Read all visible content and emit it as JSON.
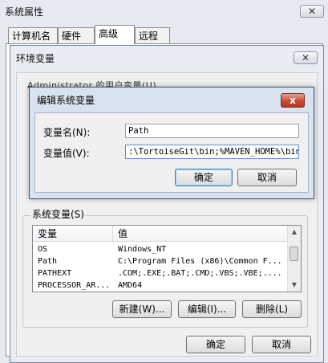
{
  "outer_window": {
    "title": "系统属性",
    "close": "✕",
    "tabs": [
      "计算机名",
      "硬件",
      "高级",
      "远程"
    ]
  },
  "env_dialog": {
    "title": "环境变量",
    "close": "✕",
    "user_vars_label": "Administrator 的用户变量(U)",
    "system_vars_label": "系统变量(S)",
    "table": {
      "headers": [
        "变量",
        "值"
      ],
      "rows": [
        [
          "OS",
          "Windows_NT"
        ],
        [
          "Path",
          "C:\\Program Files (x86)\\Common F..."
        ],
        [
          "PATHEXT",
          ".COM;.EXE;.BAT;.CMD;.VBS;.VBE;...."
        ],
        [
          "PROCESSOR_AR...",
          "AMD64"
        ]
      ]
    },
    "buttons": {
      "new": "新建(W)...",
      "edit": "编辑(I)...",
      "delete": "删除(L)"
    },
    "ok": "确定",
    "cancel": "取消"
  },
  "edit_dialog": {
    "title": "编辑系统变量",
    "close": "x",
    "name_label": "变量名(N):",
    "value_label": "变量值(V):",
    "name_value": "Path",
    "value_value": ":\\TortoiseGit\\bin;%MAVEN_HOME%\\bin;",
    "ok": "确定",
    "cancel": "取消"
  }
}
